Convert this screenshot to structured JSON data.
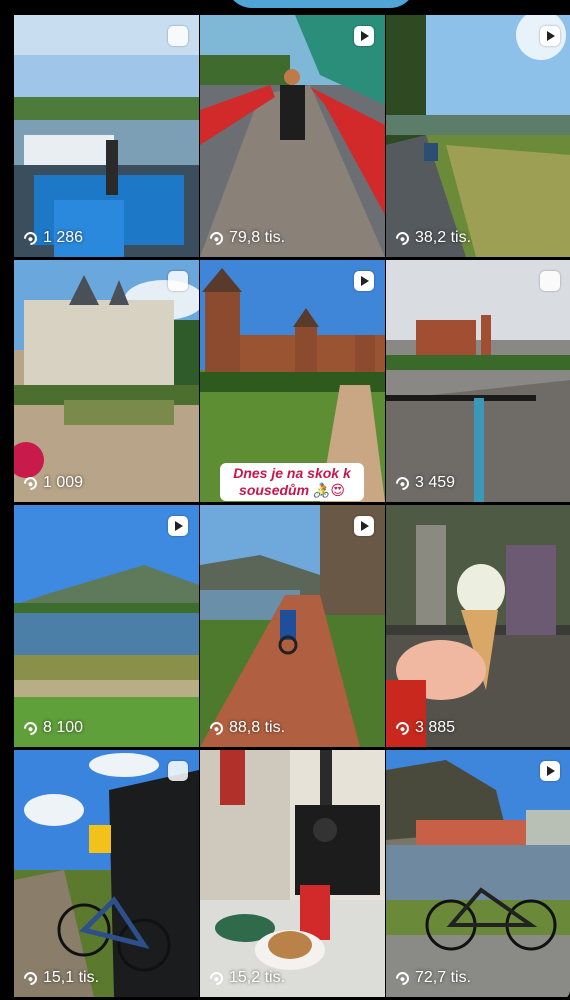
{
  "grid": {
    "tiles": [
      {
        "type": "carousel",
        "views": "1 286",
        "icon": "carousel-icon"
      },
      {
        "type": "reel",
        "views": "79,8 tis.",
        "icon": "reel-icon"
      },
      {
        "type": "reel",
        "views": "38,2 tis.",
        "icon": "reel-icon"
      },
      {
        "type": "carousel",
        "views": "1 009",
        "icon": "carousel-icon"
      },
      {
        "type": "reel",
        "views": "",
        "icon": "reel-icon",
        "sticker": "Dnes je na skok k sousedům 🚴😍"
      },
      {
        "type": "carousel",
        "views": "3 459",
        "icon": "carousel-icon"
      },
      {
        "type": "reel",
        "views": "8 100",
        "icon": "reel-icon"
      },
      {
        "type": "reel",
        "views": "88,8 tis.",
        "icon": "reel-icon"
      },
      {
        "type": "none",
        "views": "3 885",
        "icon": ""
      },
      {
        "type": "carousel",
        "views": "15,1 tis.",
        "icon": "carousel-icon"
      },
      {
        "type": "none",
        "views": "15,2 tis.",
        "icon": ""
      },
      {
        "type": "reel",
        "views": "72,7 tis.",
        "icon": "reel-icon"
      }
    ]
  },
  "view_icon": "eye-icon"
}
